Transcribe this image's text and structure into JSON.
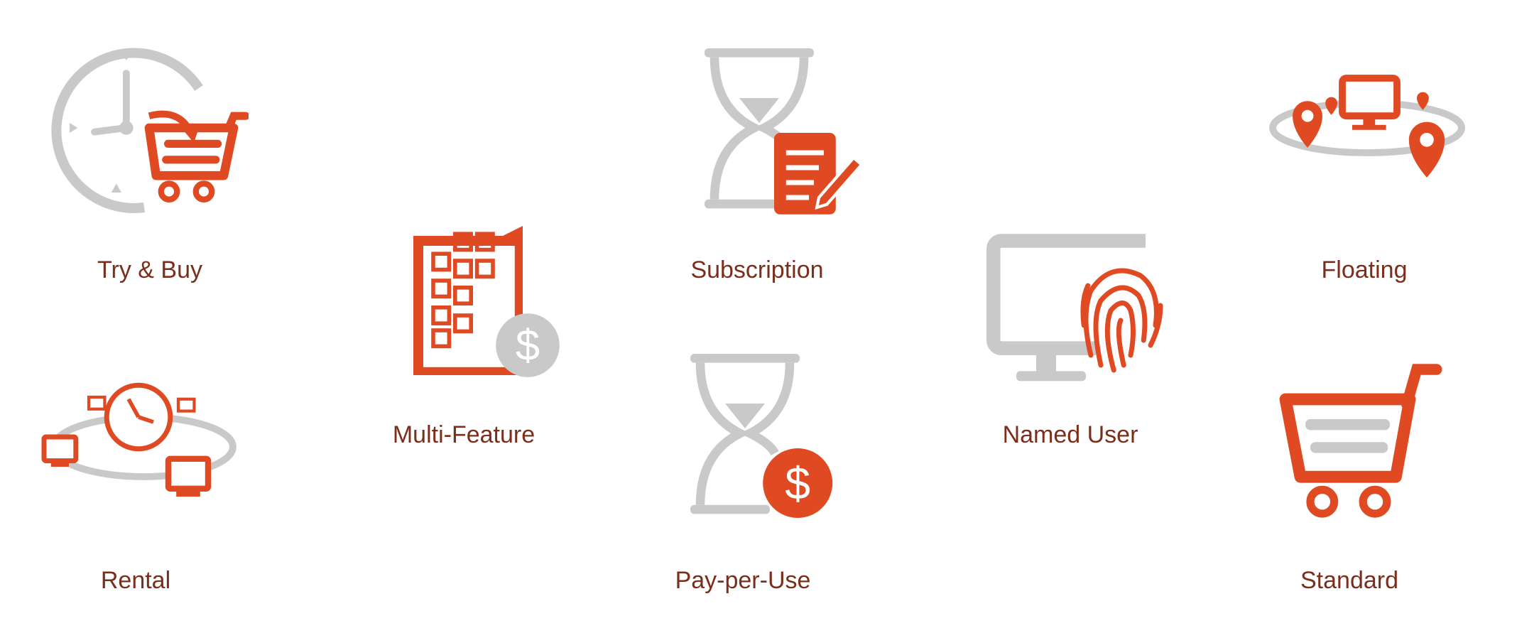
{
  "colors": {
    "accent": "#e04a22",
    "gray": "#c9c9c9",
    "label": "#7b2e1b"
  },
  "items": [
    {
      "label": "Try & Buy",
      "icon": "clock-cart-icon"
    },
    {
      "label": "Multi-Feature",
      "icon": "checklist-dollar-icon"
    },
    {
      "label": "Subscription",
      "icon": "hourglass-document-icon"
    },
    {
      "label": "Named User",
      "icon": "monitor-fingerprint-icon"
    },
    {
      "label": "Floating",
      "icon": "network-locations-icon"
    },
    {
      "label": "Rental",
      "icon": "clock-network-icon"
    },
    {
      "label": "Pay-per-Use",
      "icon": "hourglass-dollar-icon"
    },
    {
      "label": "Standard",
      "icon": "shopping-cart-icon"
    }
  ]
}
